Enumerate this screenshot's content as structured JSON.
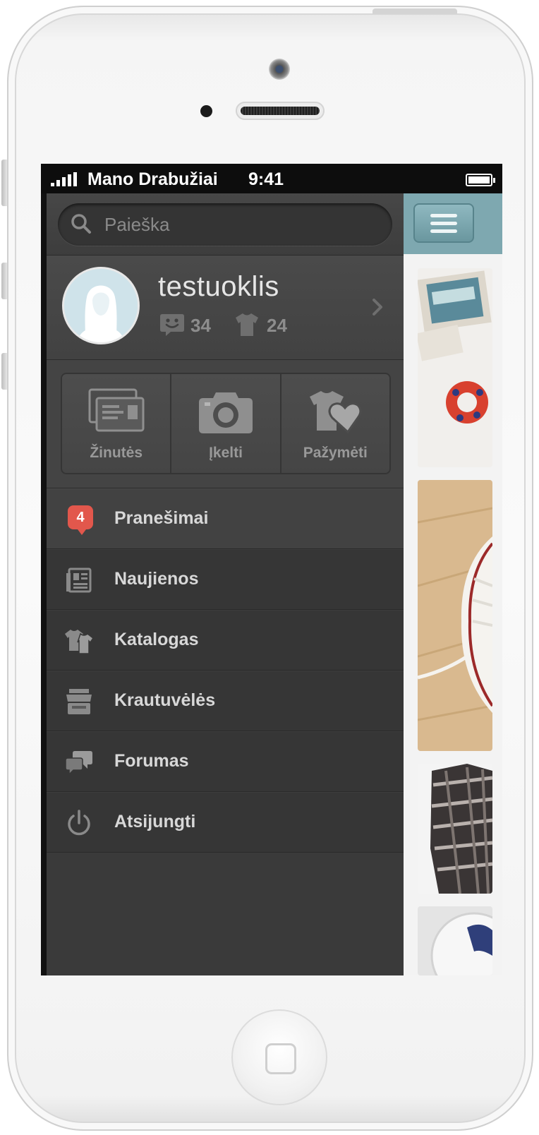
{
  "status_bar": {
    "carrier": "Mano Drabužiai",
    "time": "9:41"
  },
  "search": {
    "placeholder": "Paieška"
  },
  "profile": {
    "username": "testuoklis",
    "messages_count": "34",
    "items_count": "24"
  },
  "actions": [
    {
      "label": "Žinutės",
      "icon": "envelope-icon"
    },
    {
      "label": "Įkelti",
      "icon": "camera-icon"
    },
    {
      "label": "Pažymėti",
      "icon": "shirt-heart-icon"
    }
  ],
  "nav": [
    {
      "label": "Pranešimai",
      "icon": "notification-badge",
      "badge": "4"
    },
    {
      "label": "Naujienos",
      "icon": "newspaper-icon"
    },
    {
      "label": "Katalogas",
      "icon": "clothes-icon"
    },
    {
      "label": "Krautuvėlės",
      "icon": "shop-icon"
    },
    {
      "label": "Forumas",
      "icon": "chat-bubbles-icon"
    },
    {
      "label": "Atsijungti",
      "icon": "power-icon"
    }
  ],
  "colors": {
    "menu_bg": "#363636",
    "accent_teal": "#7ea8b0",
    "badge_red": "#e2574c"
  }
}
